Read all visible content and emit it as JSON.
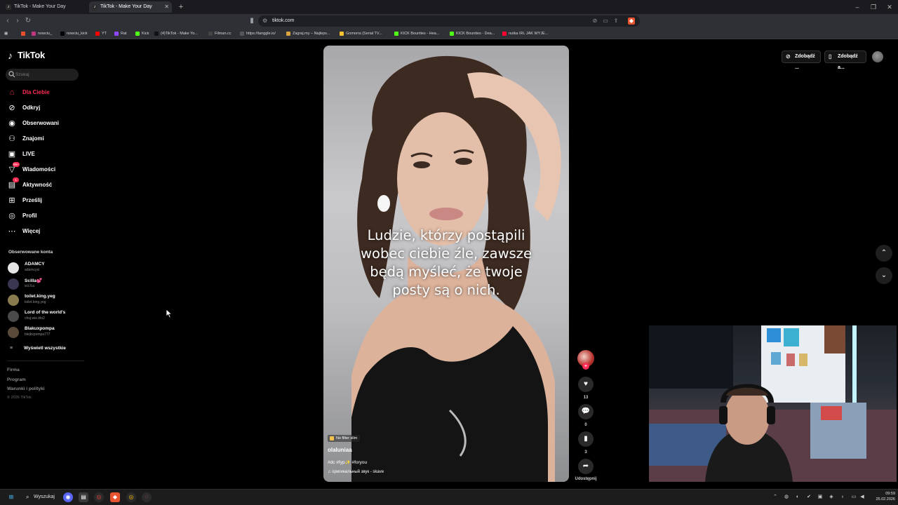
{
  "browser": {
    "tabs": [
      {
        "title": "TikTok - Make Your Day",
        "active": false
      },
      {
        "title": "TikTok - Make Your Day",
        "active": true
      }
    ],
    "url": "tiktok.com",
    "bookmarks": [
      {
        "label": "",
        "color": "#e84e2c"
      },
      {
        "label": "nowciu_",
        "color": "#c13584"
      },
      {
        "label": "nowciu_kick",
        "color": "#000000"
      },
      {
        "label": "YT",
        "color": "#ff0000"
      },
      {
        "label": "Rat",
        "color": "#9146ff"
      },
      {
        "label": "Kick",
        "color": "#53fc18"
      },
      {
        "label": "(4)TikTok - Make Yo...",
        "color": "#111111"
      },
      {
        "label": "Filman.cc",
        "color": "#444444"
      },
      {
        "label": "https://tanggle.io/",
        "color": "#555555"
      },
      {
        "label": "Zagraj.my – Najleps...",
        "color": "#d9a441"
      },
      {
        "label": "Gomorra (Serial TV...",
        "color": "#f2c230"
      },
      {
        "label": "KICK Bounties - Hea...",
        "color": "#53fc18"
      },
      {
        "label": "KICK Bounties - Dea...",
        "color": "#53fc18"
      },
      {
        "label": "nutka IRL JAK WYJE...",
        "color": "#ff0033"
      }
    ]
  },
  "sidebar": {
    "logo": "TikTok",
    "search_placeholder": "Szukaj",
    "nav": [
      {
        "label": "Dla Ciebie",
        "icon": "home-icon",
        "active": true
      },
      {
        "label": "Odkryj",
        "icon": "compass-icon"
      },
      {
        "label": "Obserwowani",
        "icon": "following-icon"
      },
      {
        "label": "Znajomi",
        "icon": "friends-icon"
      },
      {
        "label": "LIVE",
        "icon": "live-icon"
      },
      {
        "label": "Wiadomości",
        "icon": "messages-icon",
        "badge": "99+"
      },
      {
        "label": "Aktywność",
        "icon": "activity-icon",
        "badge": "1"
      },
      {
        "label": "Prześlij",
        "icon": "upload-icon"
      },
      {
        "label": "Profil",
        "icon": "profile-icon"
      },
      {
        "label": "Więcej",
        "icon": "more-icon"
      }
    ],
    "followed_title": "Obserwowane konta",
    "accounts": [
      {
        "name": "ADAMCY",
        "handle": "adamcyxi",
        "color": "#e5e5e5"
      },
      {
        "name": "Scilla💕",
        "handle": "sci.ll.a",
        "color": "#3a3550"
      },
      {
        "name": "toilet.king.yeg",
        "handle": "toilet.king.yeg",
        "color": "#8a7a4f"
      },
      {
        "name": "Lord of the world's",
        "handle": "chuj.wie.kto2",
        "color": "#4a4a4a"
      },
      {
        "name": "Blakuxpompa",
        "handle": "blejkxpompa777",
        "color": "#5a4a3a"
      }
    ],
    "show_all": "Wyświetl wszystkie",
    "footer": [
      "Firma",
      "Program",
      "Warunki i polityki"
    ],
    "copyright": "© 2026 TikTok"
  },
  "video": {
    "caption_lines": [
      "Ludzie, którzy postąpili",
      "wobec ciebie źle, zawsze",
      "będą myśleć, że twoje",
      "posty są o nich."
    ],
    "filter_tag": "No filter slim",
    "author": "olaluniaa",
    "description": "#dc #fyp✨ #foryou",
    "music": "оригинальный звук - skave"
  },
  "actions": {
    "likes": "13",
    "comments": "0",
    "saves": "3",
    "share_label": "Udostępnij"
  },
  "topright": {
    "get_coins": "Zdobądź ...",
    "get_app": "Zdobądź a..."
  },
  "taskbar": {
    "search_label": "Wyszukaj",
    "time": "09:59",
    "date": "25.02.2026"
  }
}
